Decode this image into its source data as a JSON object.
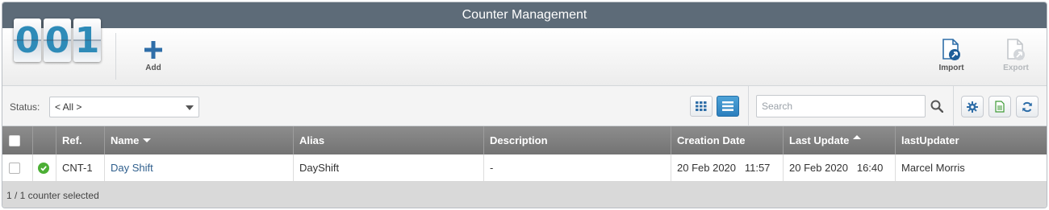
{
  "window": {
    "title": "Counter Management"
  },
  "logo": {
    "digits": [
      "0",
      "0",
      "1"
    ]
  },
  "toolbar": {
    "add_label": "Add",
    "import_label": "Import",
    "export_label": "Export"
  },
  "filter": {
    "status_label": "Status:",
    "status_value": "< All >",
    "search_placeholder": "Search"
  },
  "grid": {
    "columns": {
      "ref": "Ref.",
      "name": "Name",
      "alias": "Alias",
      "description": "Description",
      "creation_date": "Creation Date",
      "last_update": "Last Update",
      "last_updater": "lastUpdater"
    },
    "rows": [
      {
        "ref": "CNT-1",
        "name": "Day Shift",
        "alias": "DayShift",
        "description": "-",
        "creation_date": "20 Feb 2020   11:57",
        "last_update": "20 Feb 2020   16:40",
        "last_updater": "Marcel Morris",
        "status": "ok"
      }
    ]
  },
  "footer": {
    "selection_text": "1 / 1 counter selected"
  },
  "colors": {
    "title_bar": "#5d6b78",
    "accent_blue": "#2c7fbd",
    "status_ok": "#4caf35",
    "header_gray": "#808080"
  },
  "icons": {
    "add": "plus-icon",
    "import": "document-import-icon",
    "export": "document-export-icon",
    "grid_view": "grid-view-icon",
    "list_view": "list-view-icon",
    "search": "search-icon",
    "settings": "gear-icon",
    "excel": "excel-export-icon",
    "refresh": "refresh-icon",
    "status": "check-circle-icon"
  }
}
